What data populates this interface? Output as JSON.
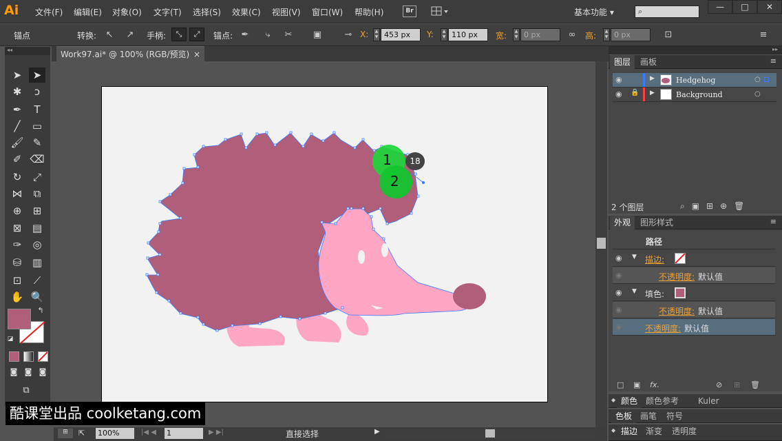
{
  "app": {
    "logo": "Ai"
  },
  "menu": [
    "文件(F)",
    "编辑(E)",
    "对象(O)",
    "文字(T)",
    "选择(S)",
    "效果(C)",
    "视图(V)",
    "窗口(W)",
    "帮助(H)"
  ],
  "bridge_label": "Br",
  "workspace": "基本功能",
  "window_buttons": [
    "—",
    "□",
    "✕"
  ],
  "control": {
    "mode_label": "锚点",
    "convert_label": "转换:",
    "handle_label": "手柄:",
    "anchor_label": "锚点:",
    "x_label": "X:",
    "x_value": "453 px",
    "y_label": "Y:",
    "y_value": "110 px",
    "w_label": "宽:",
    "w_value": "0 px",
    "h_label": "高:",
    "h_value": "0 px"
  },
  "document": {
    "tab": "Work97.ai* @ 100% (RGB/预览)",
    "close": "×"
  },
  "status": {
    "zoom": "100%",
    "page": "1",
    "tool": "直接选择"
  },
  "layers_panel": {
    "tabs": [
      "图层",
      "画板"
    ],
    "layers": [
      {
        "name": "Hedgehog",
        "color": "#3b7bff"
      },
      {
        "name": "Background",
        "color": "#ff4040"
      }
    ],
    "count_text": "2 个图层"
  },
  "appearance_panel": {
    "tabs": [
      "外观",
      "图形样式"
    ],
    "title": "路径",
    "stroke_label": "描边:",
    "opacity_label": "不透明度:",
    "opacity_value": "默认值",
    "fill_label": "填色:",
    "fill_opacity_label": "不透明度:",
    "fill_opacity_value": "默认值",
    "obj_opacity_label": "不透明度:",
    "obj_opacity_value": "默认值",
    "fx_label": "fx."
  },
  "collapsed_panels": [
    {
      "tabs": [
        "颜色",
        "颜色参考",
        "Kuler"
      ]
    },
    {
      "tabs": [
        "色板",
        "画笔",
        "符号"
      ]
    },
    {
      "tabs": [
        "描边",
        "渐变",
        "透明度"
      ]
    }
  ],
  "colors": {
    "fill": "#b15e7a",
    "body": "#b15e7a",
    "face": "#ffa6c4",
    "nose": "#b15e7a",
    "highlight": "#00cc22"
  },
  "markers": {
    "one": "1",
    "two": "2",
    "badge": "18"
  },
  "watermark": "酷课堂出品 coolketang.com"
}
